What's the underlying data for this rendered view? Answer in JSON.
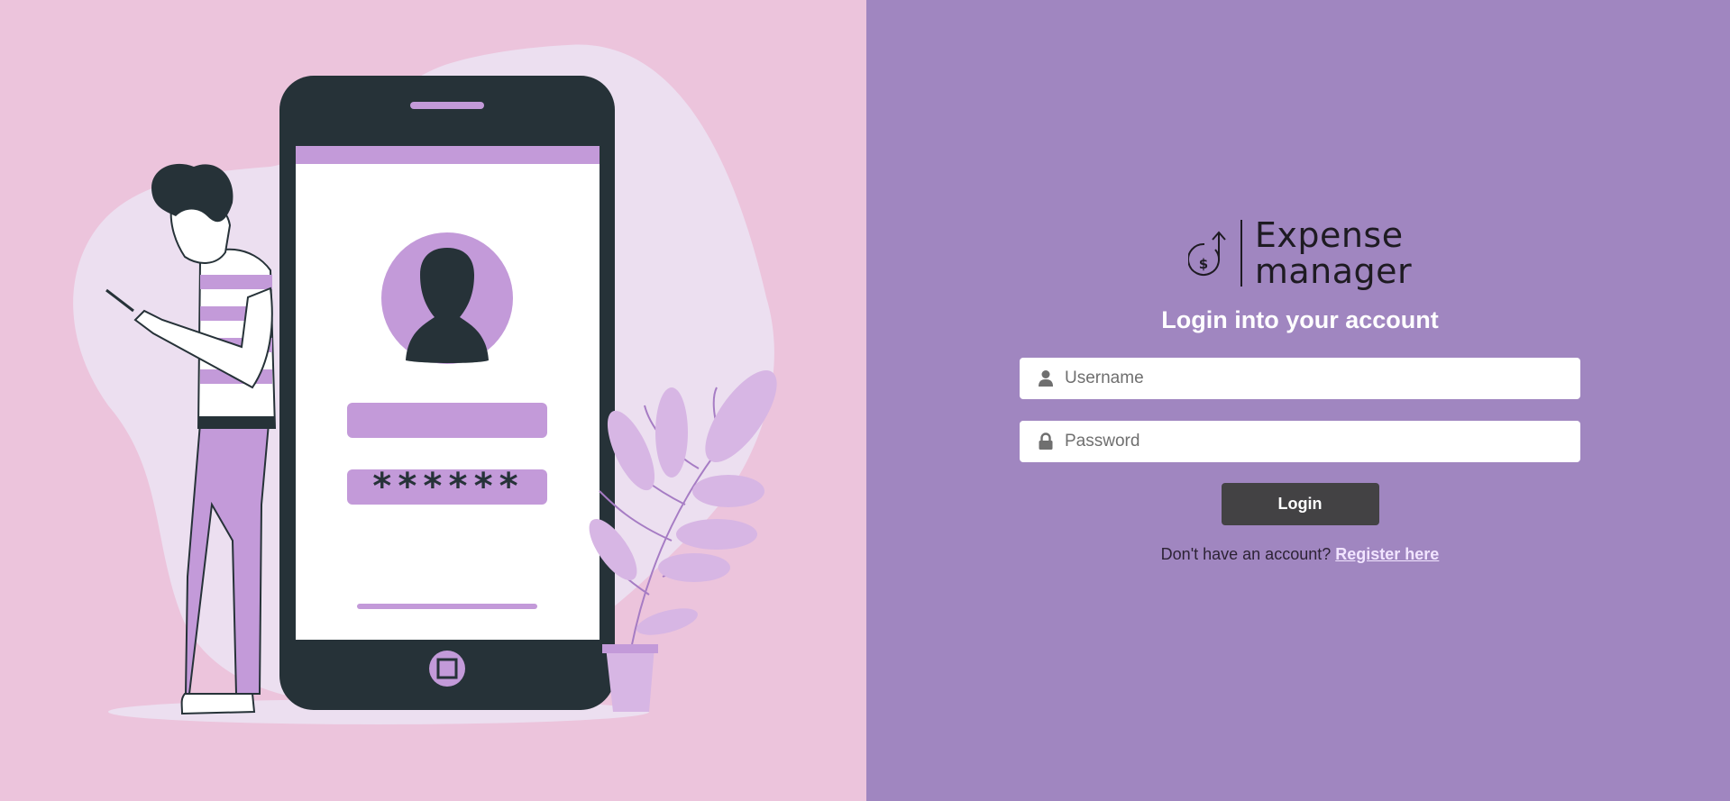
{
  "brand": {
    "line1": "Expense",
    "line2": "manager",
    "icon": "dollar-arrow-icon"
  },
  "login": {
    "title": "Login into your account",
    "username_placeholder": "Username",
    "username_value": "",
    "password_placeholder": "Password",
    "password_value": "",
    "button_label": "Login",
    "register_prompt": "Don't have an account?",
    "register_link": "Register here"
  },
  "illustration": {
    "password_mask": "******"
  },
  "colors": {
    "left_background": "#ecc4dc",
    "right_background": "#a086c0",
    "accent_purple": "#c39ad9",
    "phone_dark": "#263238",
    "button_dark": "#434244"
  }
}
